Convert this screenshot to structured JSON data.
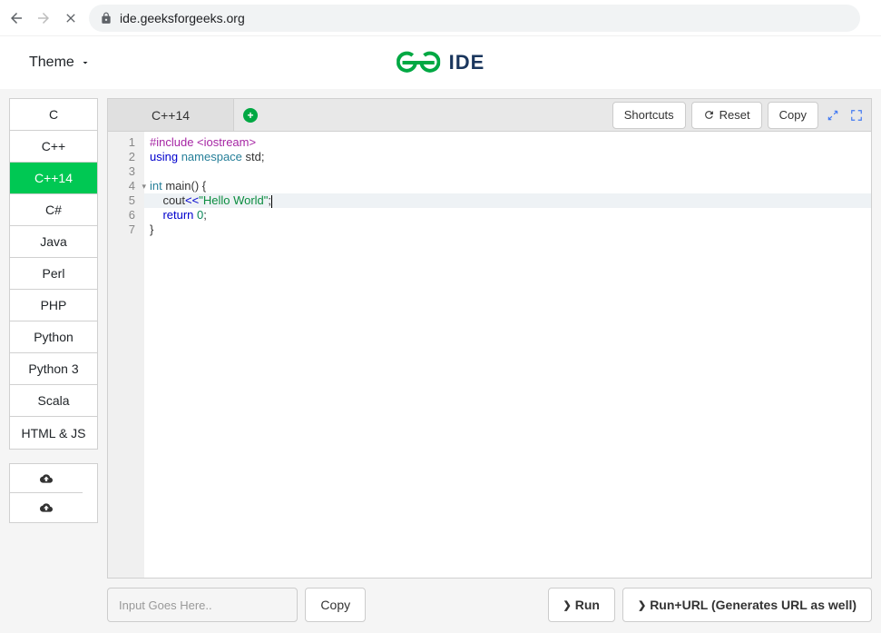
{
  "browser": {
    "url": "ide.geeksforgeeks.org"
  },
  "header": {
    "theme_label": "Theme",
    "brand_text": "IDE"
  },
  "sidebar": {
    "languages": [
      "C",
      "C++",
      "C++14",
      "C#",
      "Java",
      "Perl",
      "PHP",
      "Python",
      "Python 3",
      "Scala",
      "HTML & JS"
    ],
    "active_index": 2
  },
  "tabs": {
    "items": [
      "C++14"
    ],
    "active_index": 0
  },
  "toolbar": {
    "shortcuts_label": "Shortcuts",
    "reset_label": "Reset",
    "copy_label": "Copy"
  },
  "code": {
    "lines": [
      {
        "n": "1",
        "tokens": [
          {
            "t": "#include ",
            "c": "kw-pre"
          },
          {
            "t": "<iostream>",
            "c": "kw-pre"
          }
        ]
      },
      {
        "n": "2",
        "tokens": [
          {
            "t": "using ",
            "c": "kw-blue"
          },
          {
            "t": "namespace ",
            "c": "kw-type"
          },
          {
            "t": "std;",
            "c": "op"
          }
        ]
      },
      {
        "n": "3",
        "tokens": []
      },
      {
        "n": "4",
        "fold": true,
        "tokens": [
          {
            "t": "int ",
            "c": "kw-type"
          },
          {
            "t": "main",
            "c": "op"
          },
          {
            "t": "() {",
            "c": "op"
          }
        ]
      },
      {
        "n": "5",
        "active": true,
        "tokens": [
          {
            "t": "    cout",
            "c": "op"
          },
          {
            "t": "<<",
            "c": "kw-blue"
          },
          {
            "t": "\"Hello World\"",
            "c": "str"
          },
          {
            "t": ";",
            "c": "op"
          }
        ]
      },
      {
        "n": "6",
        "tokens": [
          {
            "t": "    ",
            "c": "op"
          },
          {
            "t": "return ",
            "c": "kw-blue"
          },
          {
            "t": "0",
            "c": "num"
          },
          {
            "t": ";",
            "c": "op"
          }
        ]
      },
      {
        "n": "7",
        "tokens": [
          {
            "t": "}",
            "c": "op"
          }
        ]
      }
    ]
  },
  "bottom": {
    "input_placeholder": "Input Goes Here..",
    "copy_label": "Copy",
    "run_label": "Run",
    "runurl_label": "Run+URL (Generates URL as well)"
  }
}
